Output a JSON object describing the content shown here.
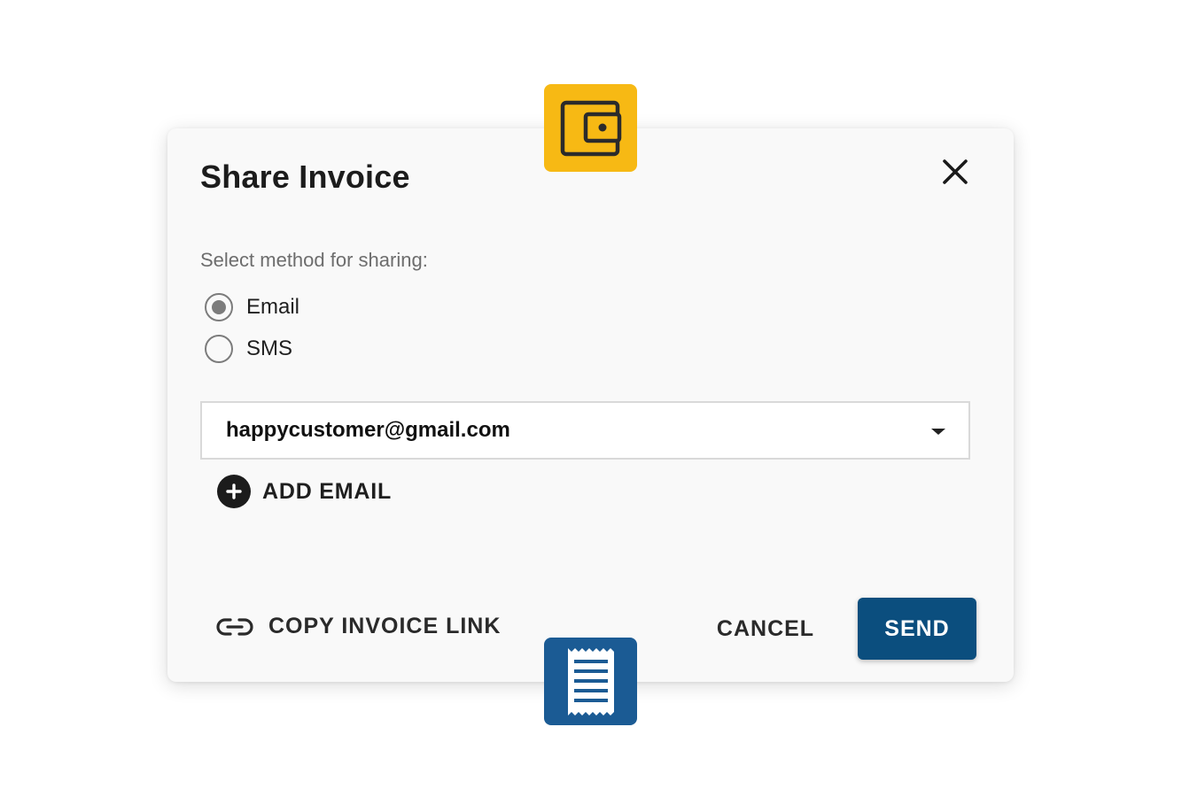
{
  "dialog": {
    "title": "Share Invoice",
    "close_icon": "close-icon",
    "prompt": "Select method for sharing:",
    "methods": [
      {
        "label": "Email",
        "selected": true
      },
      {
        "label": "SMS",
        "selected": false
      }
    ],
    "recipient_select": {
      "value": "happycustomer@gmail.com",
      "icon": "caret-down-icon"
    },
    "add_email": {
      "label": "ADD EMAIL",
      "icon": "add-circle-icon"
    },
    "copy_link": {
      "label": "COPY INVOICE LINK",
      "icon": "link-icon"
    },
    "cancel_label": "CANCEL",
    "send_label": "SEND"
  },
  "badges": {
    "top": {
      "icon": "wallet-icon",
      "color": "#f7b914"
    },
    "bottom": {
      "icon": "receipt-icon",
      "color": "#1b5b94"
    }
  },
  "colors": {
    "primary": "#0b4e7e",
    "background": "#f9f9f9"
  }
}
